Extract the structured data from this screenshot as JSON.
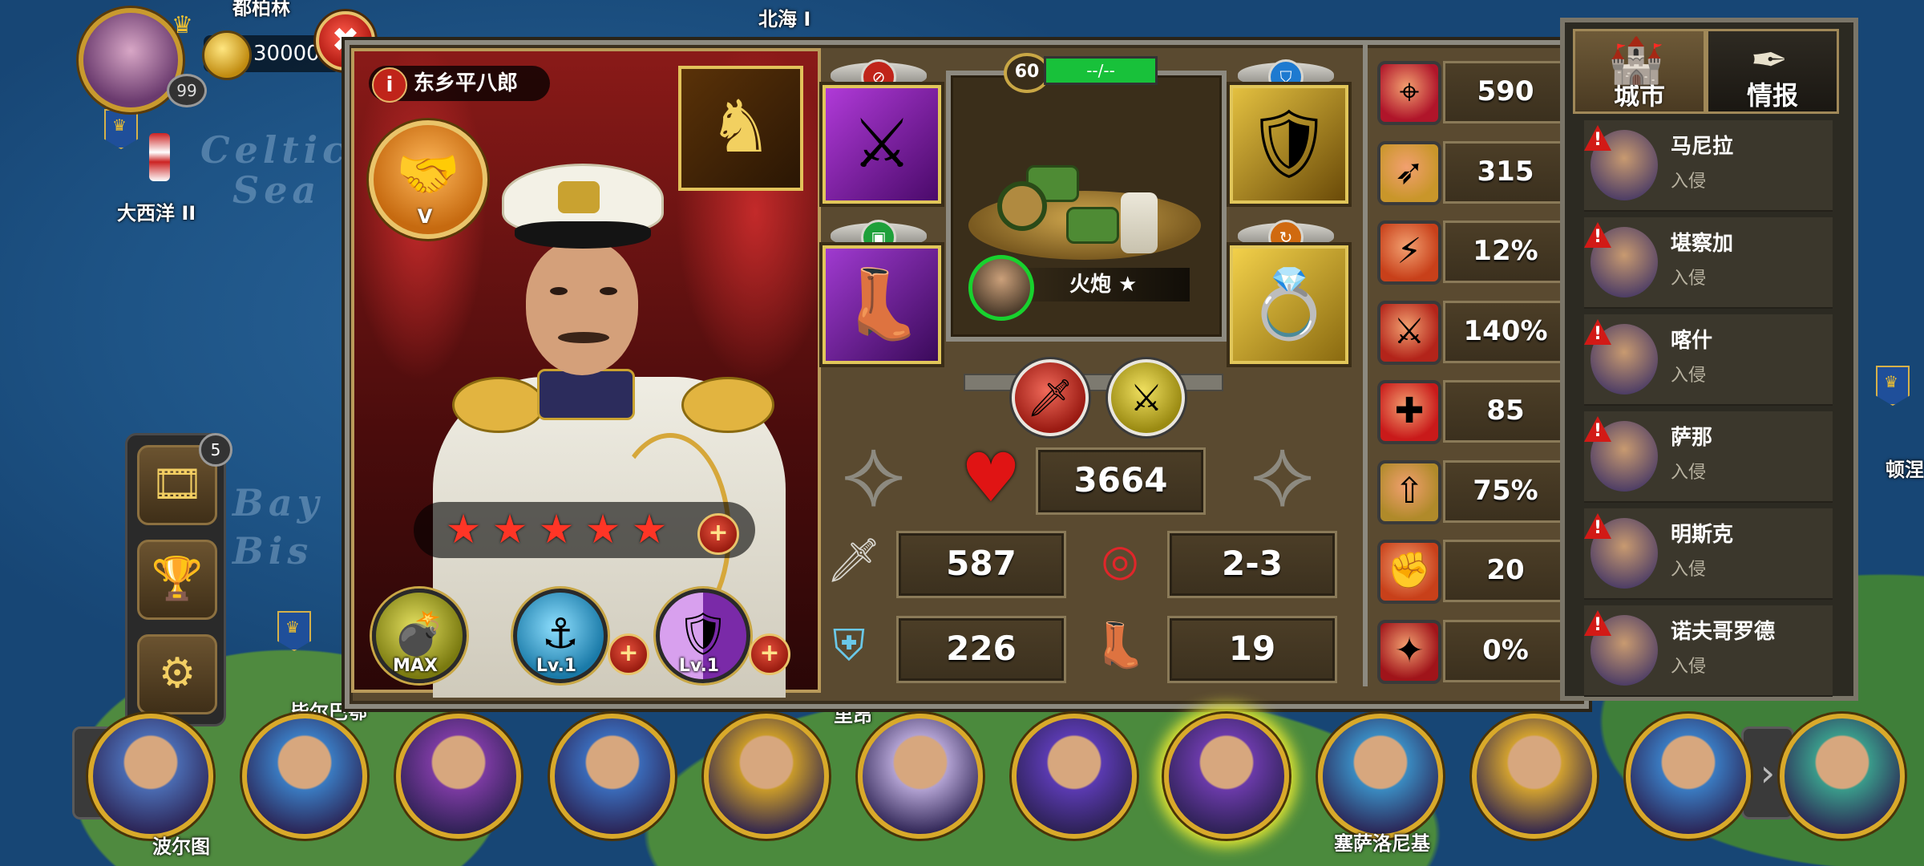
{
  "map": {
    "labels": {
      "north_sea": "北海 I",
      "atlantic": "大西洋 II",
      "top_left_cut": "都柏林",
      "bottom_left": "毕尔巴鄂",
      "bottom_mid": "里昂",
      "right_edge": "顿涅"
    },
    "sea_names": [
      "Celtic",
      "Sea",
      "Bay",
      "Bis"
    ]
  },
  "hud": {
    "coins": "30000",
    "player_level": "99",
    "close_label": "✖"
  },
  "side_menu": {
    "badge": "5",
    "buttons": [
      {
        "icon": "film-icon",
        "glyph": "🎞"
      },
      {
        "icon": "trophy-icon",
        "glyph": "🏆"
      },
      {
        "icon": "gear-icon",
        "glyph": "⚙"
      }
    ]
  },
  "hero": {
    "name": "东乡平八郎",
    "info": "i",
    "rank": "V",
    "stars": [
      "★",
      "★",
      "★",
      "★",
      "★"
    ],
    "plus": "+",
    "skills": [
      {
        "label": "MAX"
      },
      {
        "label": "Lv.1"
      },
      {
        "label": "Lv.1"
      }
    ]
  },
  "unit": {
    "level": "60",
    "bar_text": "--/--",
    "name": "火炮 ★"
  },
  "main_stats": {
    "hp": "3664",
    "attack": "587",
    "range": "2-3",
    "defense": "226",
    "move": "19"
  },
  "side_stats": [
    {
      "icon": "target-icon",
      "glyph": "⌖",
      "value": "590",
      "color": "#b0152a"
    },
    {
      "icon": "accuracy-icon",
      "glyph": "➶",
      "value": "315",
      "color": "#c9962a"
    },
    {
      "icon": "crit-icon",
      "glyph": "⚡",
      "value": "12%",
      "color": "#c8401a"
    },
    {
      "icon": "crit-damage-icon",
      "glyph": "⚔",
      "value": "140%",
      "color": "#b3241a"
    },
    {
      "icon": "heal-icon",
      "glyph": "✚",
      "value": "85",
      "color": "#c91a1a"
    },
    {
      "icon": "rank-up-icon",
      "glyph": "⇧",
      "value": "75%",
      "color": "#b08a2a"
    },
    {
      "icon": "fist-icon",
      "glyph": "✊",
      "value": "20",
      "color": "#c8401a"
    },
    {
      "icon": "figure-icon",
      "glyph": "✦",
      "value": "0%",
      "color": "#a0141a"
    }
  ],
  "intel": {
    "tabs": [
      "城市",
      "情报"
    ],
    "entries": [
      {
        "name": "马尼拉",
        "status": "入侵"
      },
      {
        "name": "堪察加",
        "status": "入侵"
      },
      {
        "name": "喀什",
        "status": "入侵"
      },
      {
        "name": "萨那",
        "status": "入侵"
      },
      {
        "name": "明斯克",
        "status": "入侵"
      },
      {
        "name": "诺夫哥罗德",
        "status": "入侵"
      }
    ],
    "warn": "!"
  },
  "bottom_heroes": {
    "labels": [
      "波尔图",
      "塞萨洛尼基"
    ]
  }
}
